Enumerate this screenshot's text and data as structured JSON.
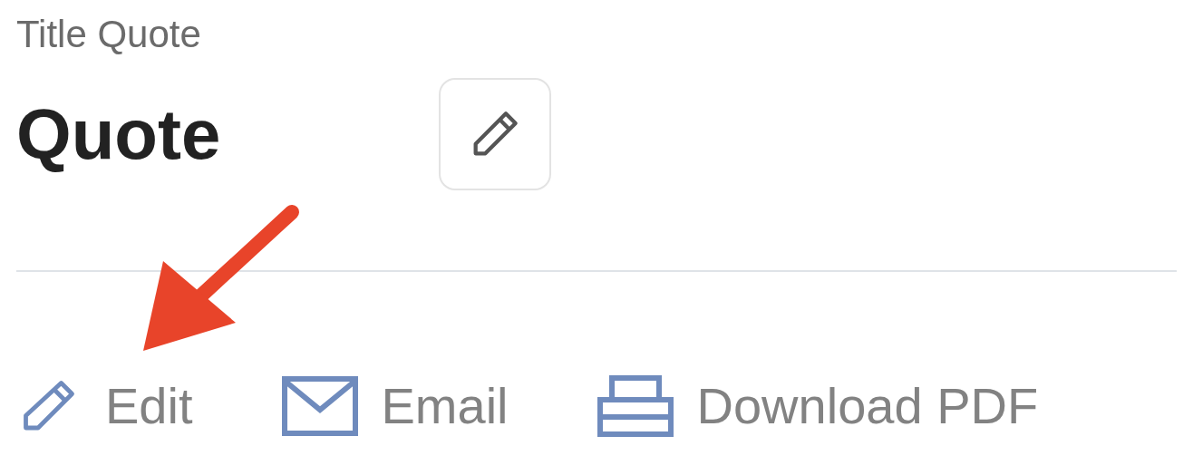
{
  "subtitle": "Title Quote",
  "title": "Quote",
  "actions": [
    {
      "label": "Edit"
    },
    {
      "label": "Email"
    },
    {
      "label": "Download PDF"
    }
  ]
}
